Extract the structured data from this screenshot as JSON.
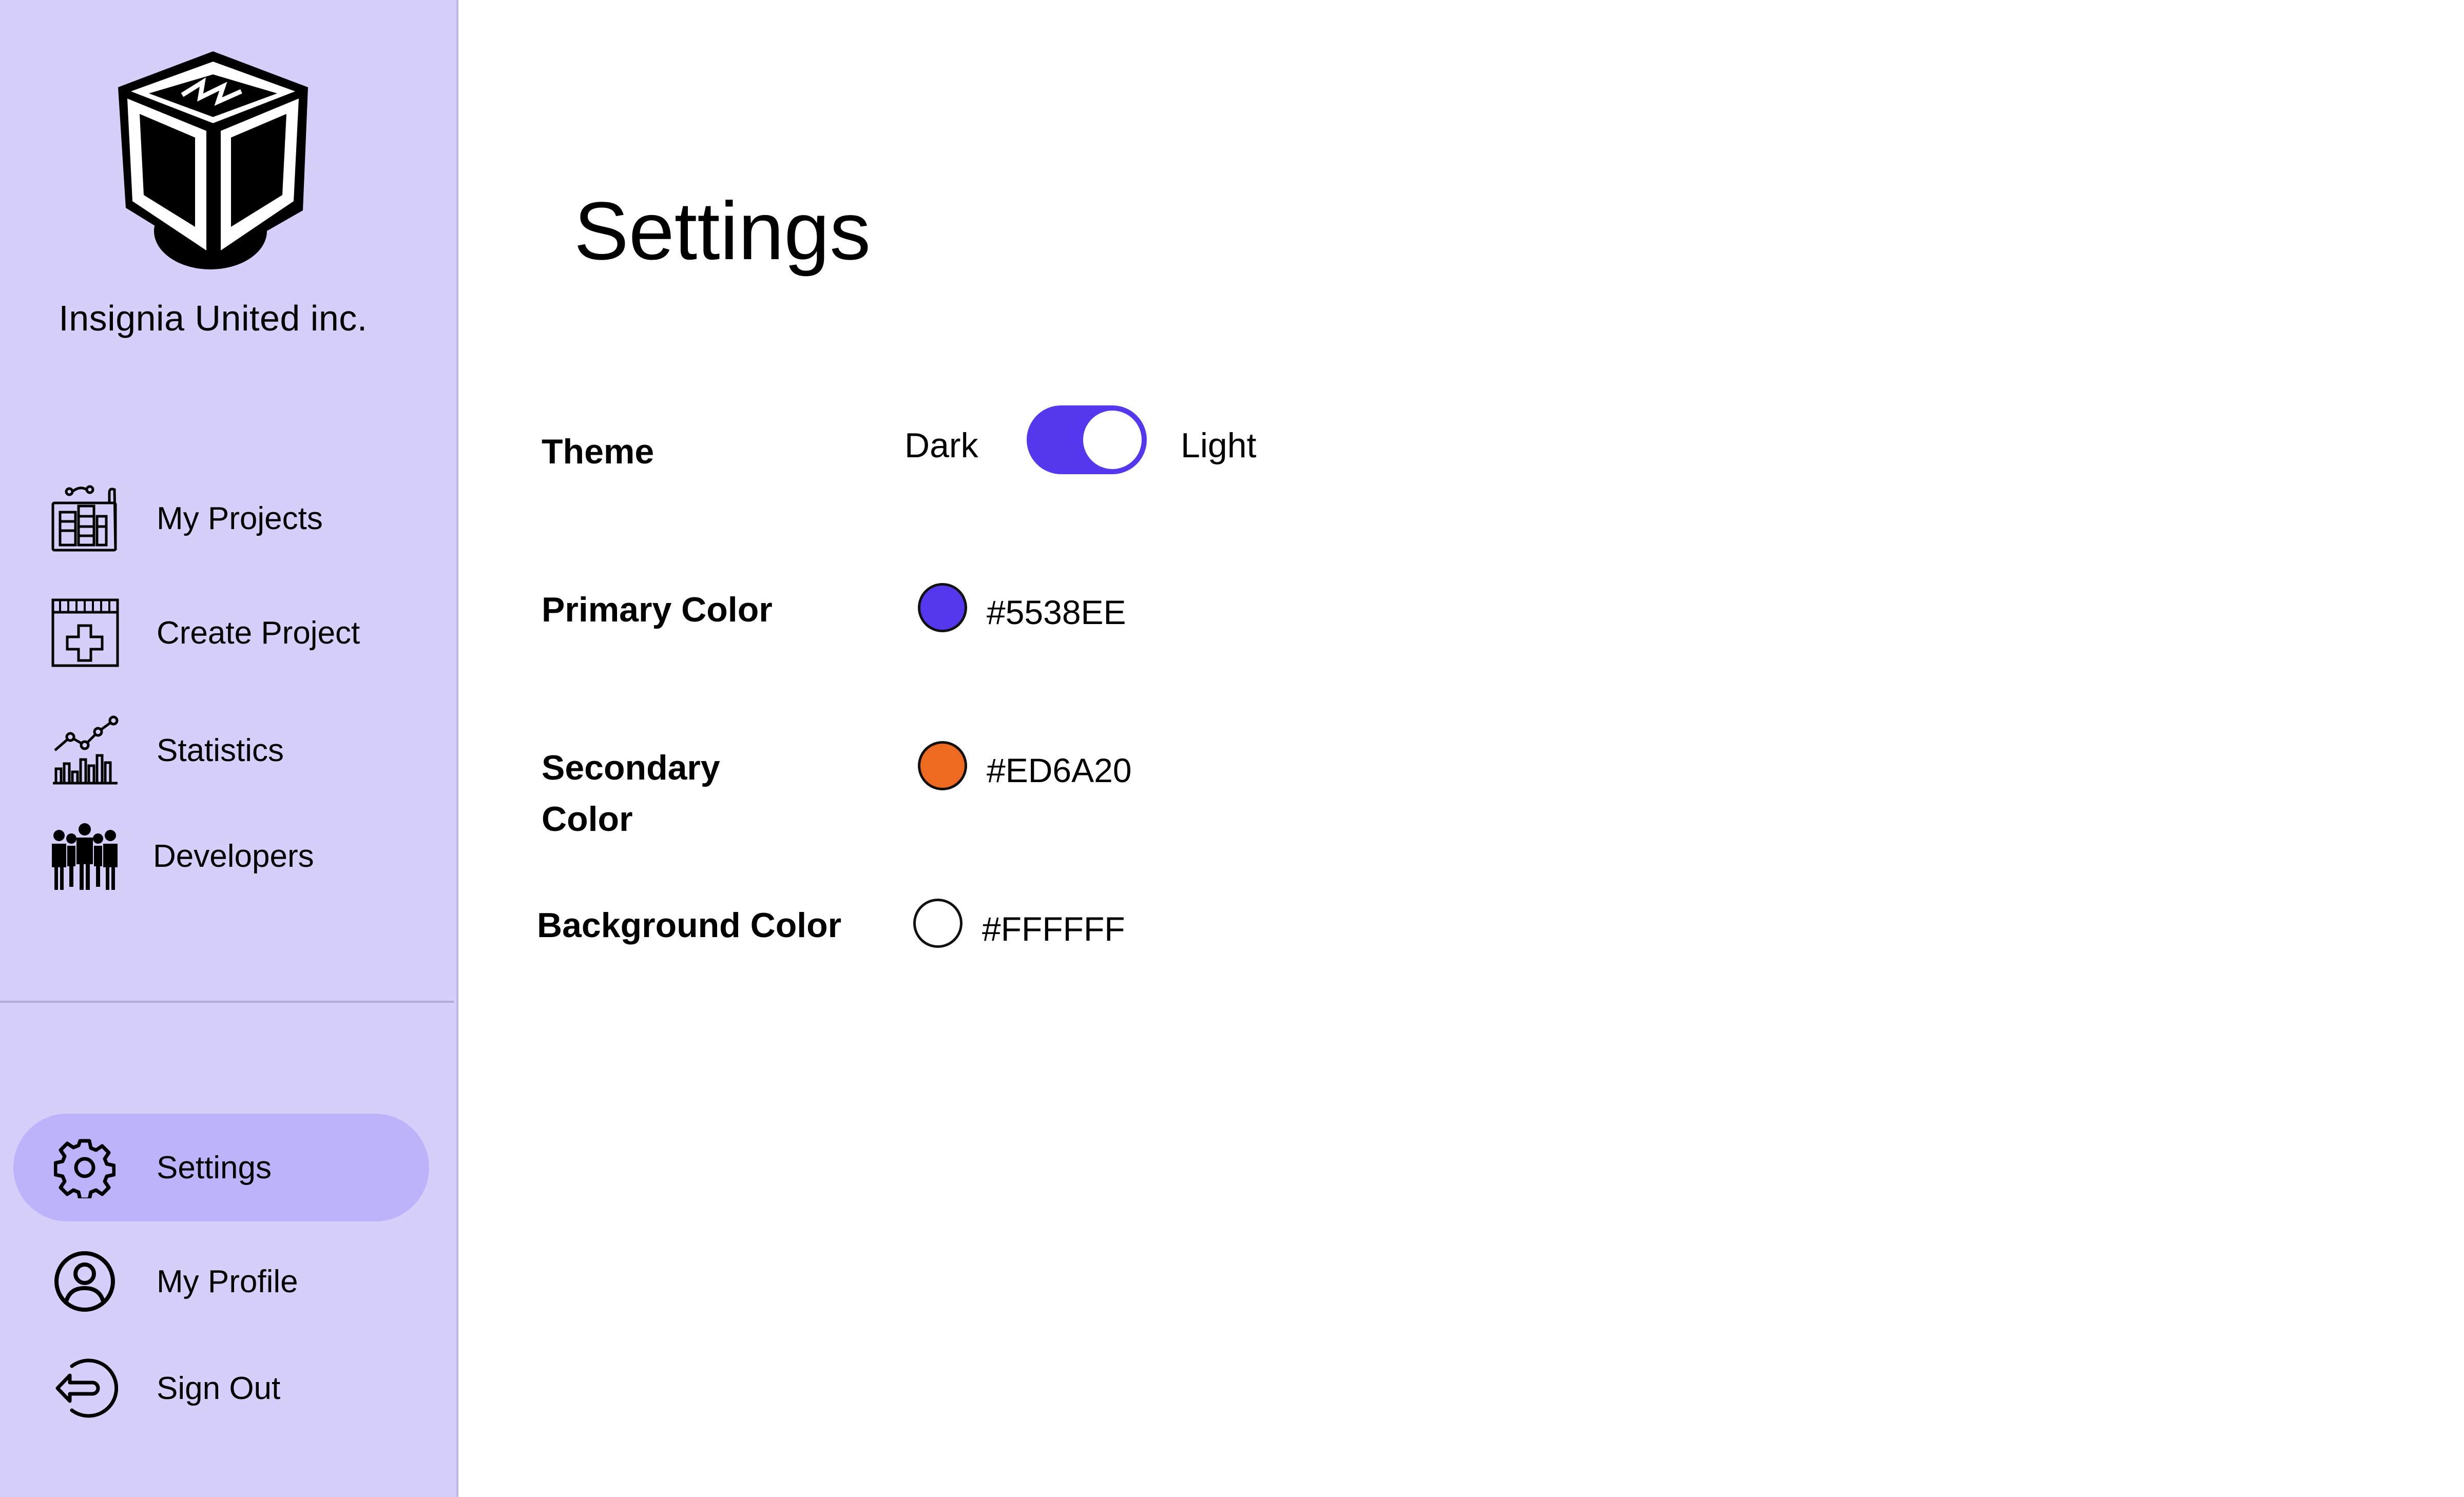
{
  "company": {
    "name": "Insignia United inc."
  },
  "sidebar": {
    "nav_top": [
      {
        "label": "My Projects",
        "icon": "blueprint-building-icon"
      },
      {
        "label": "Create Project",
        "icon": "calendar-plus-icon"
      },
      {
        "label": "Statistics",
        "icon": "line-chart-icon"
      },
      {
        "label": "Developers",
        "icon": "team-people-icon"
      }
    ],
    "nav_bottom": [
      {
        "label": "Settings",
        "icon": "gear-icon",
        "active": true
      },
      {
        "label": "My Profile",
        "icon": "user-circle-icon"
      },
      {
        "label": "Sign Out",
        "icon": "sign-out-icon"
      }
    ]
  },
  "main": {
    "title": "Settings",
    "theme": {
      "label": "Theme",
      "option_left": "Dark",
      "option_right": "Light",
      "selected": "Light"
    },
    "primary_color": {
      "label": "Primary Color",
      "value": "#5538EE"
    },
    "secondary_color": {
      "label_line1": "Secondary",
      "label_line2": "Color",
      "value": "#ED6A20"
    },
    "background_color": {
      "label": "Background Color",
      "value": "#FFFFFF"
    }
  },
  "colors": {
    "sidebar_bg": "#d5cffa",
    "active_item_bg": "#bdb3fb",
    "accent": "#5538ee"
  }
}
